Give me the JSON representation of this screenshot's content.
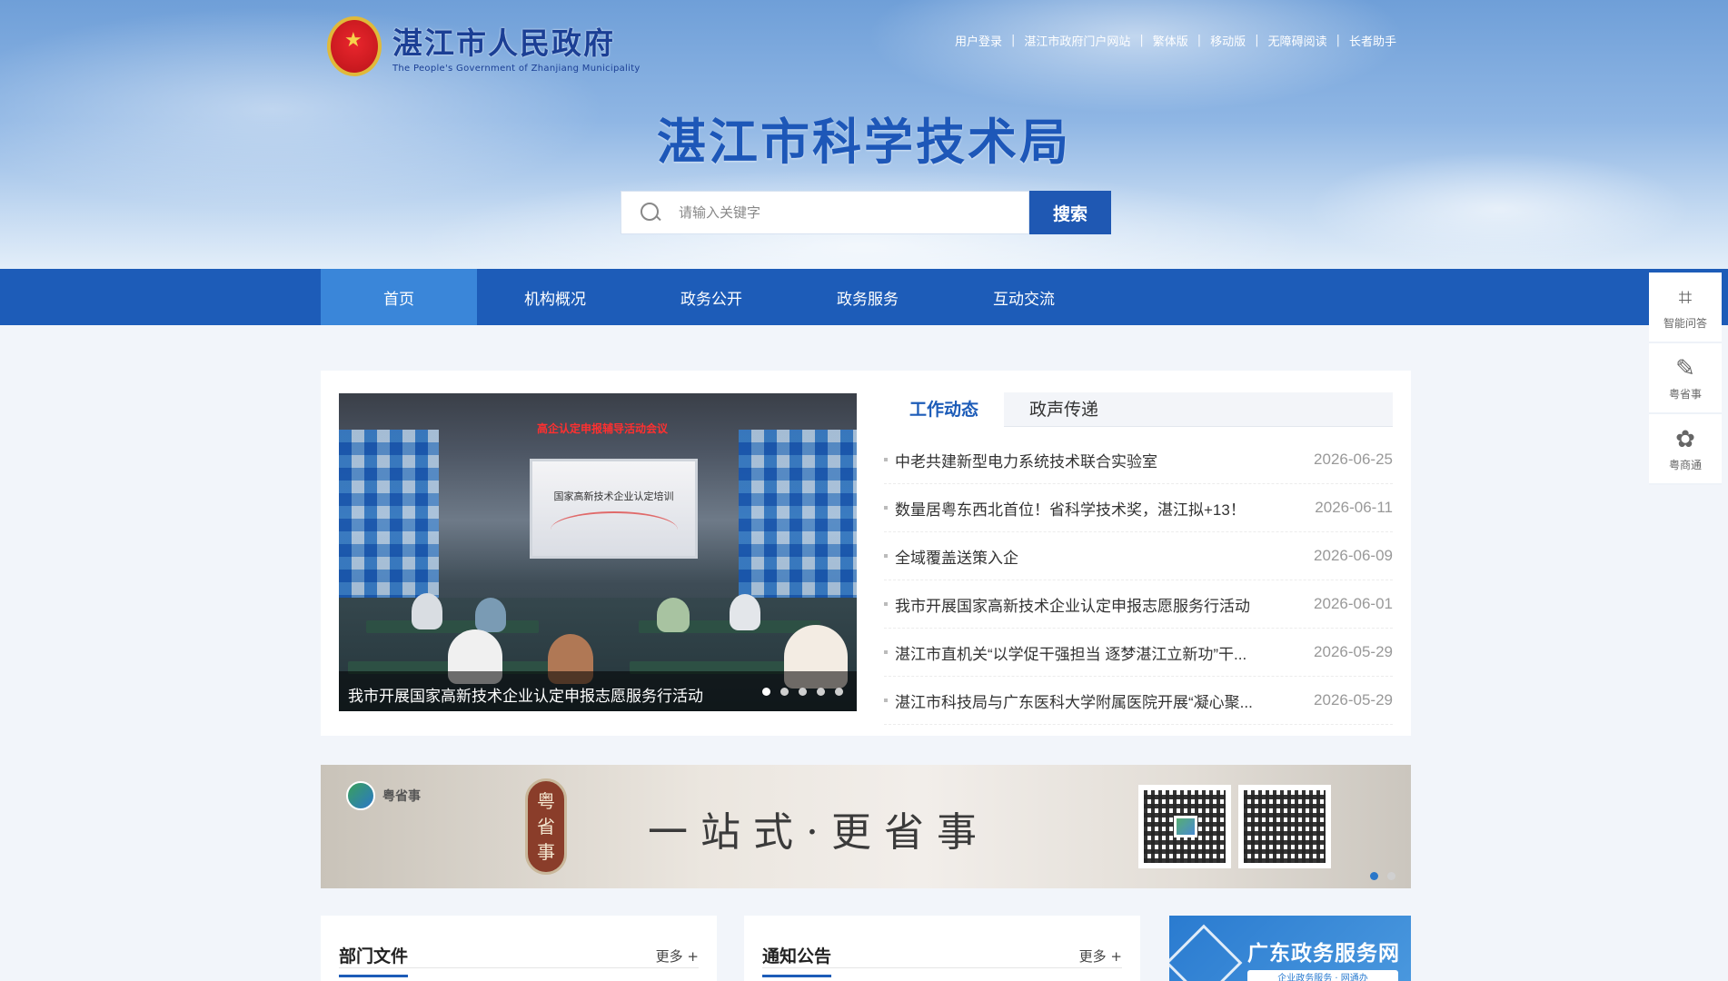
{
  "header": {
    "gov_name_cn": "湛江市人民政府",
    "gov_name_en": "The People's Government of Zhanjiang Municipality",
    "top_links": [
      "用户登录",
      "湛江市政府门户网站",
      "繁体版",
      "移动版",
      "无障碍阅读",
      "长者助手"
    ],
    "site_title": "湛江市科学技术局",
    "search": {
      "placeholder": "请输入关键字",
      "button_label": "搜索"
    }
  },
  "nav": {
    "items": [
      "首页",
      "机构概况",
      "政务公开",
      "政务服务",
      "互动交流"
    ],
    "active_index": 0
  },
  "float_bar": {
    "items": [
      {
        "label": "智能问答",
        "icon": "robot-icon"
      },
      {
        "label": "粤省事",
        "icon": "yueshengshi-icon"
      },
      {
        "label": "粤商通",
        "icon": "yueshangtong-icon"
      }
    ]
  },
  "news": {
    "slider": {
      "banner_text": "高企认定申报辅导活动会议",
      "screen_text": "国家高新技术企业认定培训",
      "caption": "我市开展国家高新技术企业认定申报志愿服务行活动",
      "dot_count": 5,
      "active_dot": 0
    },
    "tabs": [
      "工作动态",
      "政声传递"
    ],
    "active_tab": 0,
    "items": [
      {
        "title": "中老共建新型电力系统技术联合实验室",
        "date": "2026-06-25"
      },
      {
        "title": "数量居粤东西北首位！省科学技术奖，湛江拟+13！",
        "date": "2026-06-11"
      },
      {
        "title": "全域覆盖送策入企",
        "date": "2026-06-09"
      },
      {
        "title": "我市开展国家高新技术企业认定申报志愿服务行活动",
        "date": "2026-06-01"
      },
      {
        "title": "湛江市直机关“以学促干强担当 逐梦湛江立新功”干...",
        "date": "2026-05-29"
      },
      {
        "title": "湛江市科技局与广东医科大学附属医院开展“凝心聚...",
        "date": "2026-05-29"
      }
    ]
  },
  "promo": {
    "logo_text": "粤省事",
    "seal_chars": [
      "粤",
      "省",
      "事"
    ],
    "slogan": "一站式·更省事",
    "dot_count": 2,
    "active_dot": 0
  },
  "columns": [
    {
      "title": "部门文件",
      "more": "更多 +"
    },
    {
      "title": "通知公告",
      "more": "更多 +"
    }
  ],
  "gd_service": {
    "title": "广东政务服务网",
    "subtitle": "企业政务服务 · 网通办"
  },
  "colors": {
    "brand_blue": "#1d5cb8",
    "nav_active": "#3a86d9",
    "title_blue": "#1d57b8"
  }
}
